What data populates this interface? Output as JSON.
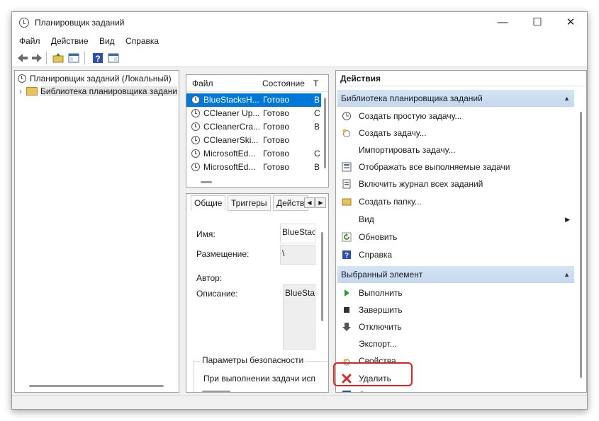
{
  "window": {
    "title": "Планировщик заданий",
    "minimize_glyph": "—",
    "maximize_glyph": "☐",
    "close_glyph": "✕"
  },
  "menu": [
    "Файл",
    "Действие",
    "Вид",
    "Справка"
  ],
  "tree": {
    "root": "Планировщик заданий (Локальный)",
    "child": "Библиотека планировщика задани",
    "expander": "›"
  },
  "task_list": {
    "columns": [
      "Файл",
      "Состояние",
      "Т"
    ],
    "rows": [
      {
        "name": "BlueStacksH...",
        "status": "Готово",
        "t": "В",
        "selected": true
      },
      {
        "name": "CCleaner Up...",
        "status": "Готово",
        "t": "С"
      },
      {
        "name": "CCleanerCra...",
        "status": "Готово",
        "t": "В"
      },
      {
        "name": "CCleanerSki...",
        "status": "Готово",
        "t": ""
      },
      {
        "name": "MicrosoftEd...",
        "status": "Готово",
        "t": "С"
      },
      {
        "name": "MicrosoftEd...",
        "status": "Готово",
        "t": "В"
      }
    ]
  },
  "details": {
    "tabs": [
      "Общие",
      "Триггеры",
      "Действ"
    ],
    "name_label": "Имя:",
    "name_value": "BlueStackl",
    "location_label": "Размещение:",
    "location_value": "\\",
    "author_label": "Автор:",
    "description_label": "Описание:",
    "description_value": "BlueStack",
    "security_group": "Параметры безопасности",
    "security_text": "При выполнении задачи исп"
  },
  "actions": {
    "header": "Действия",
    "section1": "Библиотека планировщика заданий",
    "section1_items": [
      {
        "label": "Создать простую задачу...",
        "icon": "clock-icon"
      },
      {
        "label": "Создать задачу...",
        "icon": "new-task-icon"
      },
      {
        "label": "Импортировать задачу...",
        "icon": "none"
      },
      {
        "label": "Отображать все выполняемые задачи",
        "icon": "running-tasks-icon"
      },
      {
        "label": "Включить журнал всех заданий",
        "icon": "log-icon"
      },
      {
        "label": "Создать папку...",
        "icon": "folder-icon"
      },
      {
        "label": "Вид",
        "icon": "none"
      },
      {
        "label": "Обновить",
        "icon": "refresh-icon"
      },
      {
        "label": "Справка",
        "icon": "help-icon"
      }
    ],
    "section2": "Выбранный элемент",
    "section2_items": [
      {
        "label": "Выполнить",
        "icon": "play-icon"
      },
      {
        "label": "Завершить",
        "icon": "stop-icon"
      },
      {
        "label": "Отключить",
        "icon": "disable-icon"
      },
      {
        "label": "Экспорт...",
        "icon": "none"
      },
      {
        "label": "Свойства",
        "icon": "properties-icon"
      },
      {
        "label": "Удалить",
        "icon": "delete-icon"
      },
      {
        "label": "С",
        "icon": "help-icon"
      }
    ]
  },
  "colors": {
    "selection": "#0078d7",
    "highlight": "#e02020",
    "section_bg": "#c4d7ee"
  }
}
